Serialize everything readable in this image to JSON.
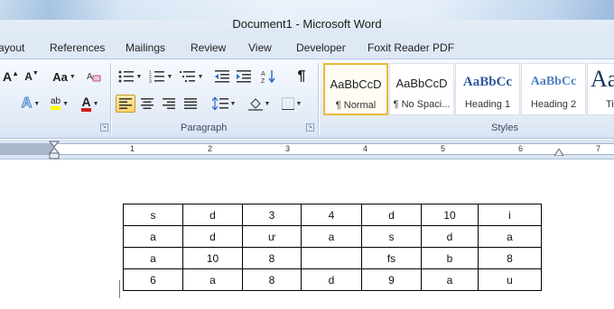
{
  "window": {
    "title": "Document1  -  Microsoft Word"
  },
  "tabs": [
    "ayout",
    "References",
    "Mailings",
    "Review",
    "View",
    "Developer",
    "Foxit Reader PDF"
  ],
  "ribbon": {
    "groups": {
      "paragraph": "Paragraph",
      "styles": "Styles"
    },
    "font_buttons": {
      "grow": "A",
      "shrink": "A",
      "change_case": "Aa",
      "highlight": "ab",
      "font_color": "A"
    },
    "pilcrow": "¶",
    "styles_gallery": [
      {
        "sample": "AaBbCcD",
        "name": "¶ Normal"
      },
      {
        "sample": "AaBbCcD",
        "name": "¶ No Spaci..."
      },
      {
        "sample": "AaBbCc",
        "name": "Heading 1"
      },
      {
        "sample": "AaBbCc",
        "name": "Heading 2"
      },
      {
        "sample": "AaB",
        "name": "Tit"
      }
    ]
  },
  "ruler": {
    "numbers": [
      "1",
      "2",
      "3",
      "4",
      "5",
      "6",
      "7"
    ]
  },
  "table": {
    "rows": [
      [
        "s",
        "d",
        "3",
        "4",
        "d",
        "10",
        "i"
      ],
      [
        "a",
        "d",
        "ư",
        "a",
        "s",
        "d",
        "a"
      ],
      [
        "a",
        "10",
        "8",
        "",
        "fs",
        "b",
        "8"
      ],
      [
        "6",
        "a",
        "8",
        "d",
        "9",
        "a",
        "u"
      ]
    ]
  },
  "colors": {
    "accent_selected": "#f8d36a",
    "heading_blue": "#2b579a",
    "font_red": "#d11b1b"
  }
}
